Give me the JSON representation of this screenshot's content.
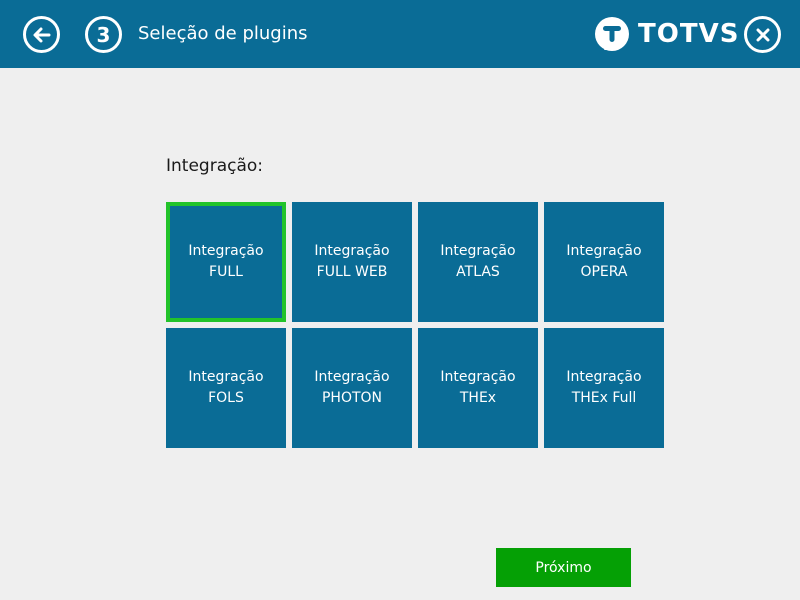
{
  "header": {
    "title": "Seleção de plugins",
    "step_number": "3",
    "logo_text": "TOTVS",
    "back_icon": "arrow-left-icon",
    "close_icon": "close-icon"
  },
  "section": {
    "label": "Integração:"
  },
  "tiles": [
    {
      "line1": "Integração",
      "line2": "FULL",
      "selected": true
    },
    {
      "line1": "Integração",
      "line2": "FULL WEB",
      "selected": false
    },
    {
      "line1": "Integração",
      "line2": "ATLAS",
      "selected": false
    },
    {
      "line1": "Integração",
      "line2": "OPERA",
      "selected": false
    },
    {
      "line1": "Integração",
      "line2": "FOLS",
      "selected": false
    },
    {
      "line1": "Integração",
      "line2": "PHOTON",
      "selected": false
    },
    {
      "line1": "Integração",
      "line2": "THEx",
      "selected": false
    },
    {
      "line1": "Integração",
      "line2": "THEx Full",
      "selected": false
    }
  ],
  "footer": {
    "next_label": "Próximo"
  },
  "colors": {
    "header_bg": "#0a6c96",
    "tile_bg": "#0a6c96",
    "selected_border": "#22c32a",
    "next_button": "#05a005",
    "page_bg": "#efefef"
  }
}
